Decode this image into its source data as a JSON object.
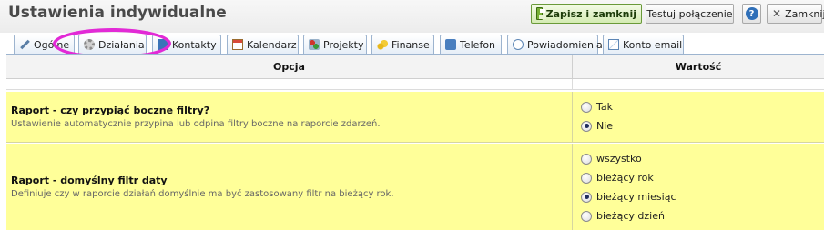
{
  "header": {
    "title": "Ustawienia indywidualne",
    "save_close_label": "Zapisz i zamknij",
    "test_connection_label": "Testuj połączenie",
    "help_label": "?",
    "close_label": "Zamknij"
  },
  "tabs": [
    {
      "label": "Ogólne",
      "icon": "wrench-icon"
    },
    {
      "label": "Działania",
      "icon": "gear-icon"
    },
    {
      "label": "Kontakty",
      "icon": "contacts-icon"
    },
    {
      "label": "Kalendarz",
      "icon": "calendar-icon"
    },
    {
      "label": "Projekty",
      "icon": "projects-icon"
    },
    {
      "label": "Finanse",
      "icon": "coins-icon"
    },
    {
      "label": "Telefon",
      "icon": "phone-icon"
    },
    {
      "label": "Powiadomienia",
      "icon": "speech-bubble-icon"
    },
    {
      "label": "Konto email",
      "icon": "envelope-icon"
    }
  ],
  "active_tab": "Działania",
  "highlight_color": "#e22ad6",
  "row_color": "#ffff99",
  "table": {
    "headers": {
      "option": "Opcja",
      "value": "Wartość"
    },
    "rows": [
      {
        "title": "Raport - czy przypiąć boczne filtry?",
        "description": "Ustawienie automatycznie przypina lub odpina filtry boczne na raporcie zdarzeń.",
        "options": [
          {
            "label": "Tak",
            "checked": false
          },
          {
            "label": "Nie",
            "checked": true
          }
        ]
      },
      {
        "title": "Raport - domyślny filtr daty",
        "description": "Definiuje czy w raporcie działań domyślnie ma być zastosowany filtr na bieżący rok.",
        "options": [
          {
            "label": "wszystko",
            "checked": false
          },
          {
            "label": "bieżący rok",
            "checked": false
          },
          {
            "label": "bieżący miesiąc",
            "checked": true
          },
          {
            "label": "bieżący dzień",
            "checked": false
          }
        ]
      }
    ]
  }
}
